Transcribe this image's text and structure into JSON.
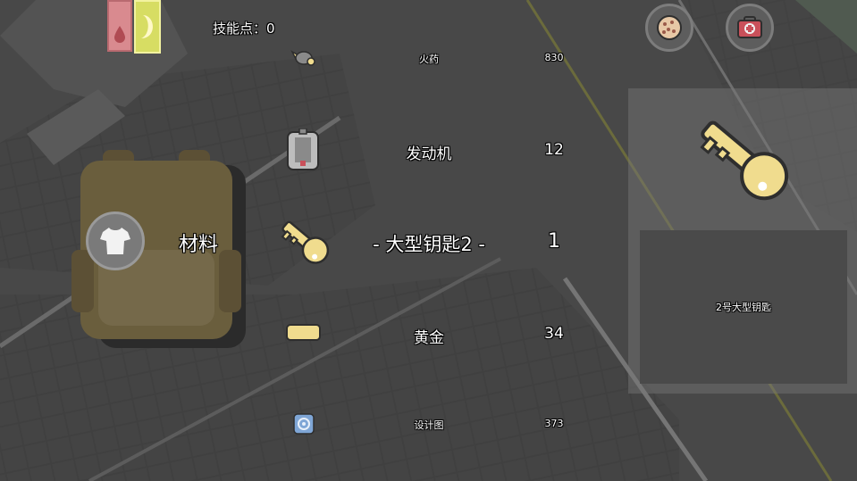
{
  "hud": {
    "skill_points_label": "技能点：0",
    "status_bars": [
      {
        "icon": "blood-drop-icon",
        "color": "#d98a8f"
      },
      {
        "icon": "hunger-crescent-icon",
        "color": "#d7dd63"
      }
    ],
    "top_right_buttons": [
      {
        "icon": "cookie-icon"
      },
      {
        "icon": "medkit-icon"
      }
    ]
  },
  "inventory": {
    "category_label": "材料",
    "clothing_button_icon": "shirt-icon",
    "items": [
      {
        "name": "火药",
        "count": "830",
        "icon": "gunpowder-icon"
      },
      {
        "name": "发动机",
        "count": "12",
        "icon": "engine-icon"
      },
      {
        "name": "- 大型钥匙2 -",
        "count": "1",
        "icon": "key-icon",
        "selected": true
      },
      {
        "name": "黄金",
        "count": "34",
        "icon": "gold-bar-icon"
      },
      {
        "name": "设计图",
        "count": "373",
        "icon": "blueprint-icon"
      }
    ]
  },
  "detail_panel": {
    "item_icon": "large-key-icon",
    "description": "2号大型钥匙"
  },
  "colors": {
    "key": "#f0dc8e",
    "outline": "#2e2e2e",
    "backpack": "#6a5e3d"
  }
}
